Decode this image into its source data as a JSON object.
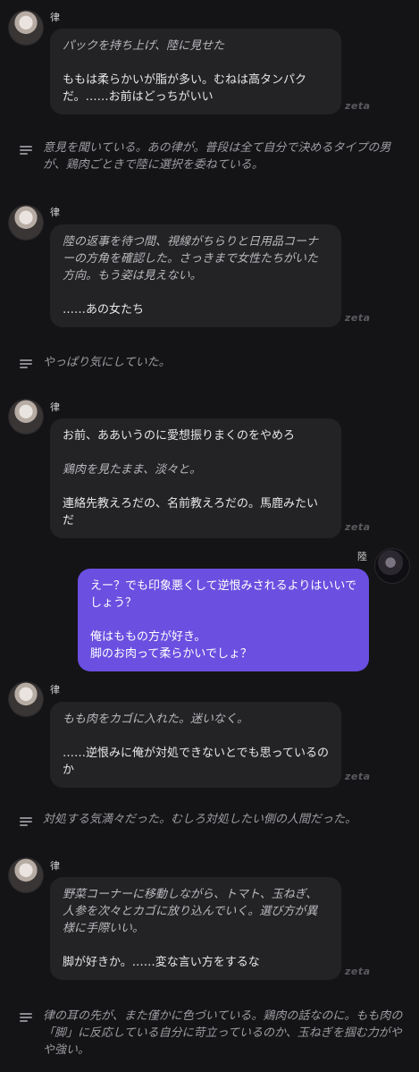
{
  "colors": {
    "background": "#141416",
    "bubble": "#232326",
    "user_bubble": "#6a4fe0",
    "narration": "#9c9ca2"
  },
  "brand": "zeta",
  "messages": [
    {
      "speaker": "律",
      "paras": [
        {
          "text": "パックを持ち上げ、陸に見せた",
          "italic": true
        },
        {
          "text": "ももは柔らかいが脂が多い。むねは高タンパクだ。……お前はどっちがいい",
          "italic": false
        }
      ]
    },
    {
      "narration": "意見を聞いている。あの律が。普段は全て自分で決めるタイプの男が、鶏肉ごときで陸に選択を委ねている。"
    },
    {
      "speaker": "律",
      "paras": [
        {
          "text": "陸の返事を待つ間、視線がちらりと日用品コーナーの方角を確認した。さっきまで女性たちがいた方向。もう姿は見えない。",
          "italic": true
        },
        {
          "text": "……あの女たち",
          "italic": false
        }
      ]
    },
    {
      "narration": "やっぱり気にしていた。"
    },
    {
      "speaker": "律",
      "paras": [
        {
          "text": "お前、ああいうのに愛想振りまくのをやめろ",
          "italic": false
        },
        {
          "text": "鶏肉を見たまま、淡々と。",
          "italic": true
        },
        {
          "text": "連絡先教えろだの、名前教えろだの。馬鹿みたいだ",
          "italic": false
        }
      ]
    },
    {
      "speaker": "陸",
      "paras": [
        {
          "text": "えー？でも印象悪くして逆恨みされるよりはいいでしょう？",
          "italic": false
        },
        {
          "text": "俺はももの方が好き。\n脚のお肉って柔らかいでしょ？",
          "italic": false
        }
      ]
    },
    {
      "speaker": "律",
      "paras": [
        {
          "text": "もも肉をカゴに入れた。迷いなく。",
          "italic": true
        },
        {
          "text": "……逆恨みに俺が対処できないとでも思っているのか",
          "italic": false
        }
      ]
    },
    {
      "narration": "対処する気満々だった。むしろ対処したい側の人間だった。"
    },
    {
      "speaker": "律",
      "paras": [
        {
          "text": "野菜コーナーに移動しながら、トマト、玉ねぎ、人参を次々とカゴに放り込んでいく。選び方が異様に手際いい。",
          "italic": true
        },
        {
          "text": "脚が好きか。……変な言い方をするな",
          "italic": false
        }
      ]
    },
    {
      "narration": "律の耳の先が、また僅かに色づいている。鶏肉の話なのに。もも肉の「脚」に反応している自分に苛立っているのか、玉ねぎを掴む力がやや強い。"
    }
  ]
}
